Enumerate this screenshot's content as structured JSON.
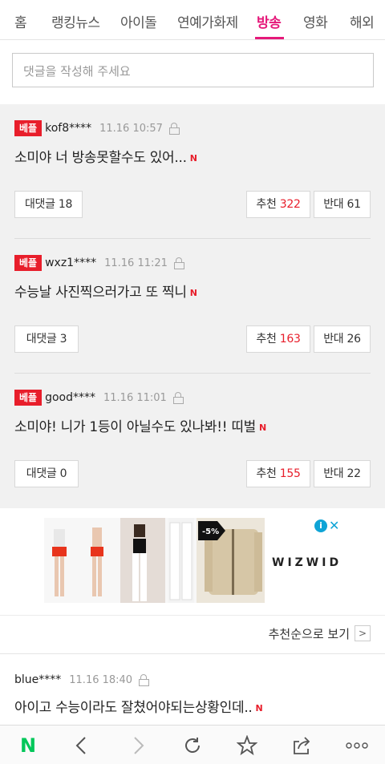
{
  "tabs": [
    "홈",
    "랭킹뉴스",
    "아이돌",
    "연예가화제",
    "방송",
    "영화",
    "해외"
  ],
  "active_tab": "방송",
  "comment_input": {
    "placeholder": "댓글을 작성해 주세요"
  },
  "best_badge": "베플",
  "n_mark": "N",
  "best_comments": [
    {
      "user": "kof8****",
      "time": "11.16 10:57",
      "text": "소미야 너 방송못할수도 있어...",
      "reply_label": "대댓글",
      "reply_count": "18",
      "like_label": "추천",
      "like_count": "322",
      "dislike_label": "반대",
      "dislike_count": "61"
    },
    {
      "user": "wxz1****",
      "time": "11.16 11:21",
      "text": "수능날 사진찍으러가고 또 찍니",
      "reply_label": "대댓글",
      "reply_count": "3",
      "like_label": "추천",
      "like_count": "163",
      "dislike_label": "반대",
      "dislike_count": "26"
    },
    {
      "user": "good****",
      "time": "11.16 11:01",
      "text": "소미야! 니가 1등이 아닐수도 있나봐!! 띠벌",
      "reply_label": "대댓글",
      "reply_count": "0",
      "like_label": "추천",
      "like_count": "155",
      "dislike_label": "반대",
      "dislike_count": "22"
    }
  ],
  "ad": {
    "brand": "WIZWID",
    "discount": "-5%"
  },
  "sort": {
    "label": "추천순으로 보기"
  },
  "comments": [
    {
      "user": "blue****",
      "time": "11.16 18:40",
      "text": "아이고 수능이라도 잘쳤어야되는상황인데.."
    }
  ],
  "toolbar": {
    "logo": "N"
  },
  "colors": {
    "accent": "#e5197a",
    "badge": "#e81e2b",
    "naver_green": "#03c75a"
  }
}
